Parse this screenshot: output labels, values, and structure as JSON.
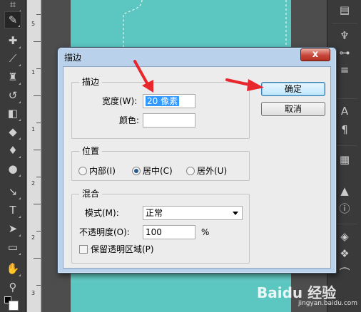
{
  "dialog": {
    "title": "描边",
    "close_glyph": "x",
    "ok_label": "确定",
    "cancel_label": "取消",
    "stroke_group": {
      "legend": "描边",
      "width_label": "宽度(W):",
      "width_value": "20 像素",
      "color_label": "颜色:"
    },
    "position_group": {
      "legend": "位置",
      "options": [
        "内部(I)",
        "居中(C)",
        "居外(U)"
      ],
      "selected": "居中(C)"
    },
    "blend_group": {
      "legend": "混合",
      "mode_label": "模式(M):",
      "mode_value": "正常",
      "opacity_label": "不透明度(O):",
      "opacity_value": "100",
      "opacity_unit": "%",
      "preserve_label": "保留透明区域(P)"
    }
  },
  "ruler": {
    "numbers": [
      "5",
      "1",
      "1",
      "2",
      "2",
      "3"
    ]
  },
  "watermark": {
    "brand": "Bai​du 经验",
    "url": "jingyan.baidu.com"
  },
  "colors": {
    "canvas": "#5cc6c1",
    "annotation_arrow": "#e8262b",
    "selection": "#3399ff"
  }
}
